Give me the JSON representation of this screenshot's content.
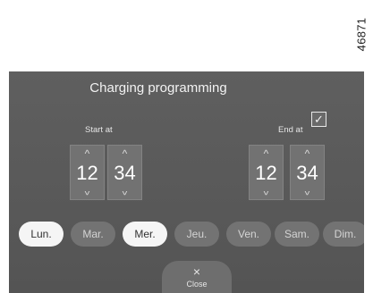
{
  "figure_ref": "46871",
  "screen": {
    "title": "Charging programming",
    "start": {
      "label": "Start at",
      "hours": "12",
      "minutes": "34"
    },
    "end": {
      "label": "End at",
      "checked": true,
      "hours": "12",
      "minutes": "34"
    },
    "arrow_up": "^",
    "arrow_down": "^",
    "check_glyph": "✓",
    "days": [
      {
        "label": "Lun.",
        "selected": true
      },
      {
        "label": "Mar.",
        "selected": false
      },
      {
        "label": "Mer.",
        "selected": true
      },
      {
        "label": "Jeu.",
        "selected": false
      },
      {
        "label": "Ven.",
        "selected": false
      },
      {
        "label": "Sam.",
        "selected": false
      },
      {
        "label": "Dim.",
        "selected": false
      }
    ],
    "close": {
      "icon": "close-icon",
      "glyph": "×",
      "label": "Close"
    }
  },
  "colors": {
    "screen_bg": "#5b5b5b",
    "selected_day_bg": "#f5f5f5",
    "unselected_day_bg": "#737373",
    "text_light": "#f2f2f2"
  }
}
